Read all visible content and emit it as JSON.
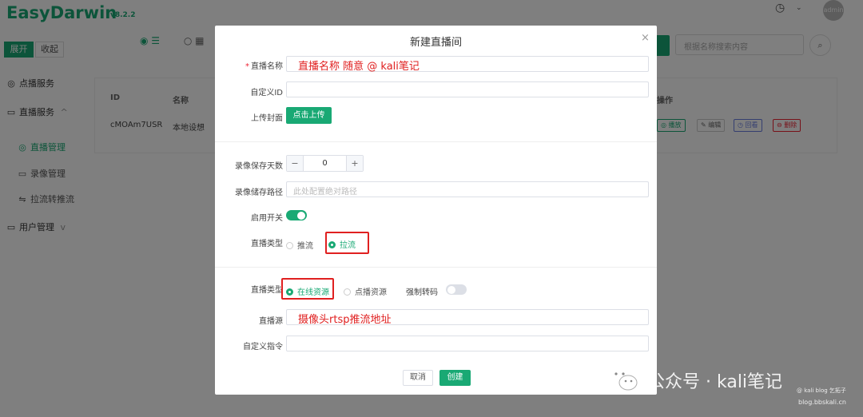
{
  "app": {
    "brand": "EasyDarwin",
    "version": "v8.2.2",
    "user": "admin"
  },
  "sidebar": {
    "expand_label": "展开",
    "collapse_label": "收起",
    "items": [
      {
        "label": "点播服务",
        "icon": "play-circle-icon"
      },
      {
        "label": "直播服务",
        "icon": "monitor-icon",
        "chevron": "^"
      },
      {
        "label": "直播管理",
        "icon": "play-circle-icon",
        "active": true
      },
      {
        "label": "录像管理",
        "icon": "video-icon"
      },
      {
        "label": "拉流转推流",
        "icon": "transfer-icon"
      },
      {
        "label": "用户管理",
        "icon": "monitor-icon",
        "chevron": "v"
      }
    ]
  },
  "search": {
    "placeholder": "根据名称搜索内容"
  },
  "table": {
    "headers": [
      "ID",
      "名称",
      "操作"
    ],
    "rows": [
      {
        "id": "cMOAm7USR",
        "name": "本地设想"
      }
    ],
    "actions": [
      "播放",
      "编辑",
      "回看",
      "删除"
    ]
  },
  "dialog": {
    "title": "新建直播间",
    "close": "×",
    "fields": {
      "name_label": "直播名称",
      "name_value": "直播名称 随意 @ kali笔记",
      "custom_id_label": "自定义ID",
      "cover_label": "上传封面",
      "upload_button": "点击上传",
      "retention_label": "录像保存天数",
      "retention_value": "0",
      "stepper_minus": "−",
      "stepper_plus": "+",
      "storage_path_label": "录像储存路径",
      "storage_path_placeholder": "此处配置绝对路径",
      "enable_label": "启用开关",
      "live_type_label": "直播类型",
      "live_type_options": [
        "推流",
        "拉流"
      ],
      "source_type_label": "直播类型",
      "source_type_options": [
        "在线资源",
        "点播资源"
      ],
      "force_transcode_label": "强制转码",
      "source_label": "直播源",
      "source_value": "摄像头rtsp推流地址",
      "custom_cmd_label": "自定义指令"
    },
    "buttons": {
      "cancel": "取消",
      "create": "创建"
    }
  },
  "watermark": {
    "main": "公众号 · kali笔记",
    "small1": "@ kali blog 乞拓子",
    "small2": "blog.bbskali.cn"
  },
  "colors": {
    "accent": "#19a974",
    "highlight": "#e02020"
  }
}
